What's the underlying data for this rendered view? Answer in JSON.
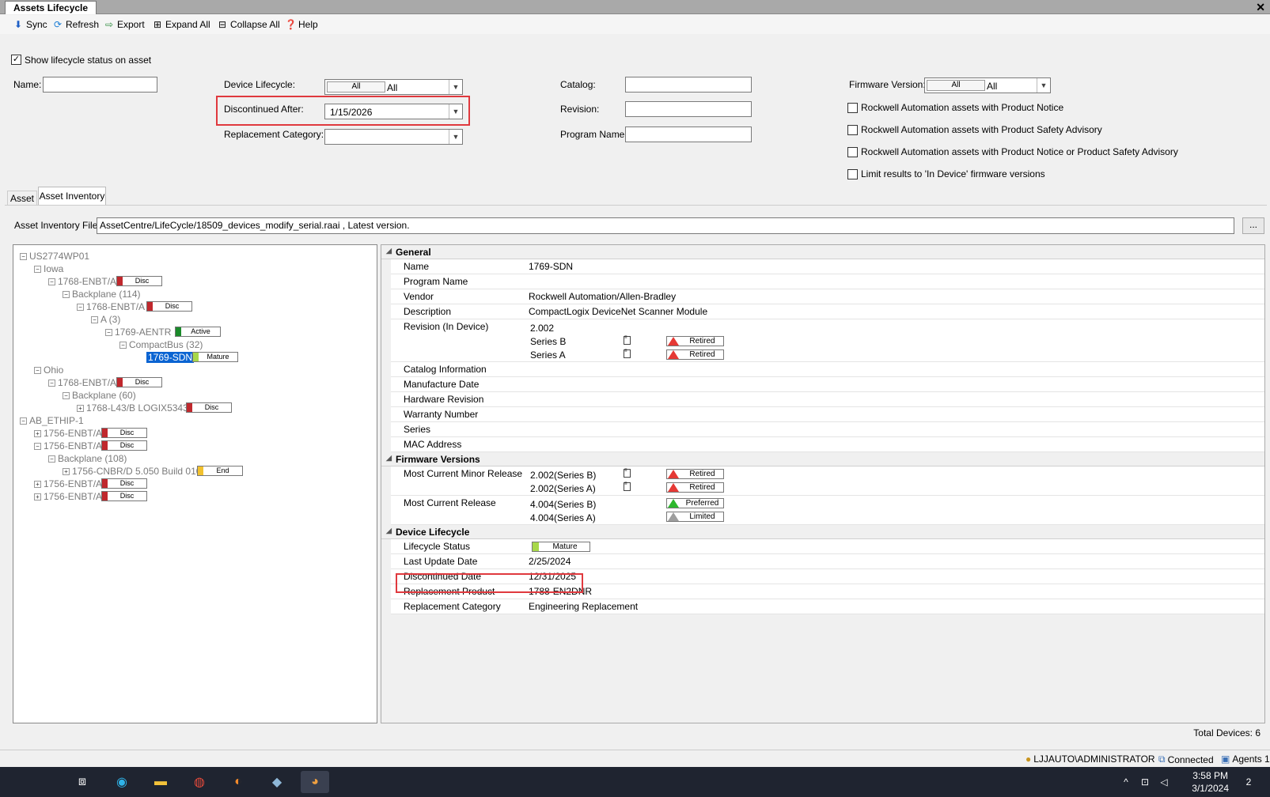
{
  "app": {
    "tab_title": "Assets Lifecycle",
    "close": "✕"
  },
  "toolbar": {
    "sync": "Sync",
    "refresh": "Refresh",
    "export": "Export",
    "expand_all": "Expand All",
    "collapse_all": "Collapse All",
    "help": "Help"
  },
  "filters": {
    "show_status_label": "Show lifecycle status on asset",
    "name_label": "Name:",
    "device_lifecycle_label": "Device Lifecycle:",
    "device_lifecycle_all_btn": "All",
    "device_lifecycle_value": "All",
    "discontinued_after_label": "Discontinued After:",
    "discontinued_after_value": "1/15/2026",
    "replacement_category_label": "Replacement Category:",
    "catalog_label": "Catalog:",
    "revision_label": "Revision:",
    "program_name_label": "Program Name:",
    "firmware_version_label": "Firmware Version:",
    "firmware_all_btn": "All",
    "firmware_value": "All",
    "chk_product_notice": "Rockwell Automation assets with Product Notice",
    "chk_safety_advisory": "Rockwell Automation assets with Product Safety Advisory",
    "chk_notice_or_advisory": "Rockwell Automation assets with Product Notice or Product Safety Advisory",
    "chk_limit_in_device": "Limit results to 'In Device' firmware versions"
  },
  "tabs": {
    "asset": "Asset",
    "inventory": "Asset Inventory"
  },
  "inventory_file": {
    "label": "Asset Inventory File:",
    "value": "AssetCentre/LifeCycle/18509_devices_modify_serial.raai , Latest version.",
    "browse": "..."
  },
  "tree": [
    {
      "label": "US2774WP01",
      "exp": "−"
    },
    {
      "label": "Iowa",
      "exp": "−"
    },
    {
      "label": "1768-ENBT/A",
      "exp": "−",
      "badge": "Disc",
      "color": "#c0282d"
    },
    {
      "label": "Backplane (114)",
      "exp": "−"
    },
    {
      "label": "1768-ENBT/A",
      "exp": "−",
      "badge": "Disc",
      "color": "#c0282d"
    },
    {
      "label": "A (3)",
      "exp": "−"
    },
    {
      "label": "1769-AENTR",
      "exp": "−",
      "badge": "Active",
      "color": "#1a8a2a"
    },
    {
      "label": "CompactBus (32)",
      "exp": "−"
    },
    {
      "label": "1769-SDN",
      "badge": "Mature",
      "color": "#a8d84a",
      "selected": true
    },
    {
      "label": "Ohio",
      "exp": "−"
    },
    {
      "label": "1768-ENBT/A",
      "exp": "−",
      "badge": "Disc",
      "color": "#c0282d"
    },
    {
      "label": "Backplane (60)",
      "exp": "−"
    },
    {
      "label": "1768-L43/B LOGIX5343",
      "exp": "+",
      "badge": "Disc",
      "color": "#c0282d"
    },
    {
      "label": "AB_ETHIP-1",
      "exp": "−"
    },
    {
      "label": "1756-ENBT/A",
      "exp": "+",
      "badge": "Disc",
      "color": "#c0282d"
    },
    {
      "label": "1756-ENBT/A",
      "exp": "−",
      "badge": "Disc",
      "color": "#c0282d"
    },
    {
      "label": "Backplane (108)",
      "exp": "−"
    },
    {
      "label": "1756-CNBR/D 5.050 Build 010",
      "exp": "+",
      "badge": "End",
      "color": "#f2c12e"
    },
    {
      "label": "1756-ENBT/A",
      "exp": "+",
      "badge": "Disc",
      "color": "#c0282d"
    },
    {
      "label": "1756-ENBT/A",
      "exp": "+",
      "badge": "Disc",
      "color": "#c0282d"
    }
  ],
  "props": {
    "general_title": "General",
    "name_label": "Name",
    "name_value": "1769-SDN",
    "program_name_label": "Program Name",
    "vendor_label": "Vendor",
    "vendor_value": "Rockwell Automation/Allen-Bradley",
    "description_label": "Description",
    "description_value": "CompactLogix DeviceNet Scanner Module",
    "revision_label": "Revision (In Device)",
    "revision_value": "2.002",
    "series_b": "Series B",
    "series_a": "Series A",
    "retired": "Retired",
    "catalog_info_label": "Catalog Information",
    "manufacture_date_label": "Manufacture Date",
    "hardware_revision_label": "Hardware Revision",
    "warranty_label": "Warranty Number",
    "series_label": "Series",
    "mac_label": "MAC Address",
    "firmware_title": "Firmware Versions",
    "minor_release_label": "Most Current Minor Release",
    "minor_b": "2.002(Series B)",
    "minor_a": "2.002(Series A)",
    "current_release_label": "Most Current Release",
    "current_b": "4.004(Series B)",
    "current_a": "4.004(Series A)",
    "preferred": "Preferred",
    "limited": "Limited",
    "lifecycle_title": "Device Lifecycle",
    "lifecycle_status_label": "Lifecycle Status",
    "lifecycle_status_value": "Mature",
    "last_update_label": "Last Update Date",
    "last_update_value": "2/25/2024",
    "discontinued_date_label": "Discontinued Date",
    "discontinued_date_value": "12/31/2025",
    "replacement_product_label": "Replacement Product",
    "replacement_product_value": "1788-EN2DNR",
    "replacement_category_label": "Replacement Category",
    "replacement_category_value": "Engineering Replacement"
  },
  "total_devices": "Total Devices: 6",
  "statusbar": {
    "user": "LJJAUTO\\ADMINISTRATOR",
    "connection": "Connected",
    "agents": "Agents 1"
  },
  "taskbar": {
    "time": "3:58 PM",
    "date": "3/1/2024",
    "notifications": "2"
  },
  "colors": {
    "highlight_box": "#e0393e",
    "selection": "#0a64d2",
    "retired": "#e53935",
    "preferred": "#2eb82e",
    "limited": "#9e9e9e"
  }
}
